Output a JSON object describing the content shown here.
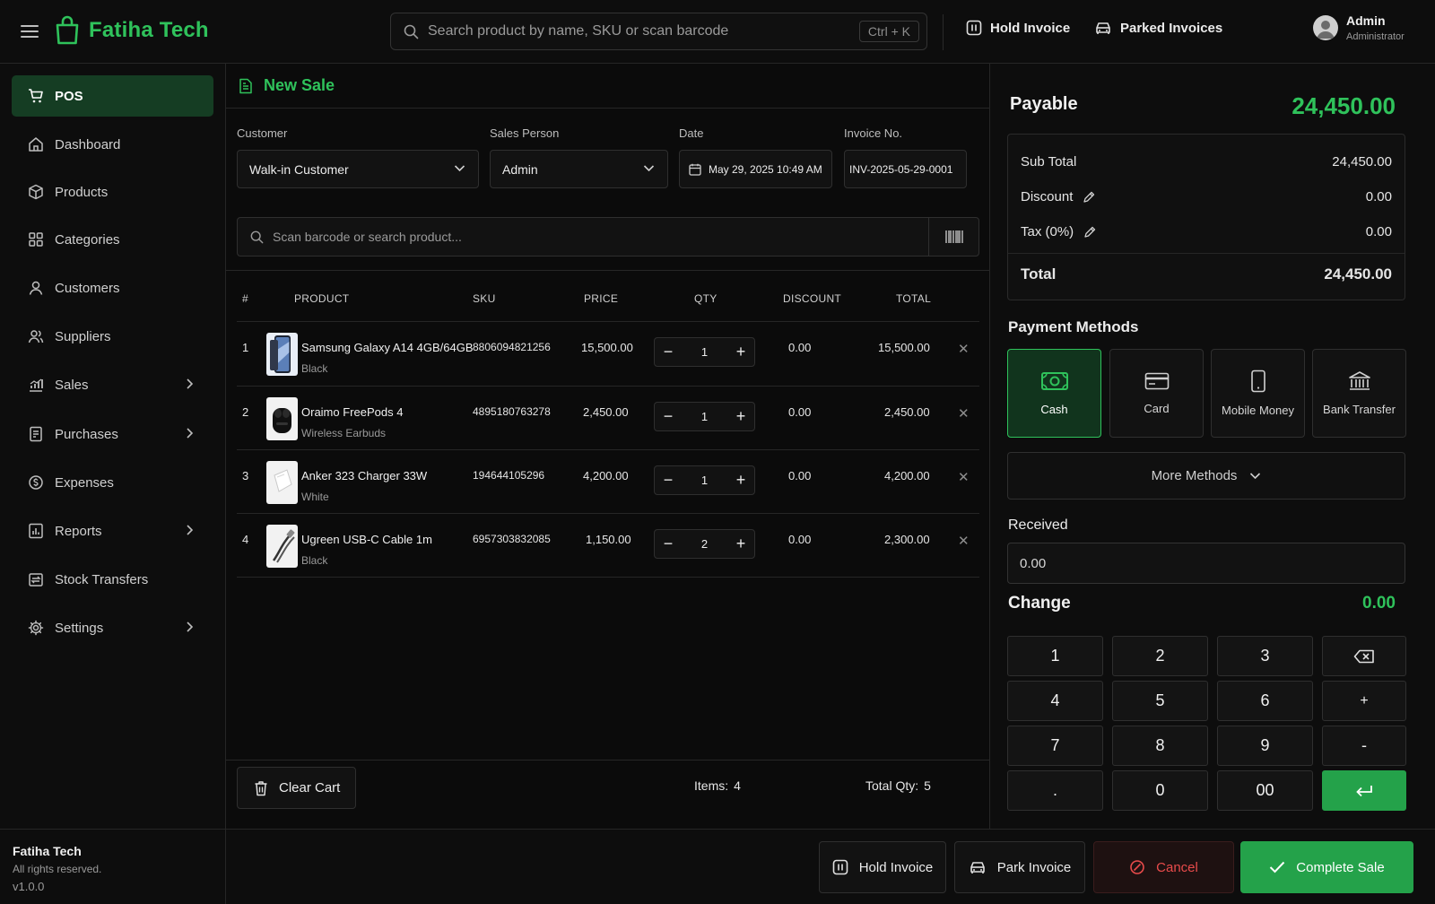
{
  "app": {
    "name": "Fatiha Tech",
    "search_placeholder": "Search product by name, SKU or scan barcode",
    "search_shortcut": "Ctrl + K",
    "hold_invoice": "Hold Invoice",
    "parked_invoices": "Parked Invoices",
    "user": {
      "name": "Admin",
      "role": "Administrator"
    }
  },
  "sidebar": {
    "items": [
      {
        "label": "POS",
        "icon": "cart-icon",
        "active": true
      },
      {
        "label": "Dashboard",
        "icon": "home-icon"
      },
      {
        "label": "Products",
        "icon": "box-icon"
      },
      {
        "label": "Categories",
        "icon": "grid-icon"
      },
      {
        "label": "Customers",
        "icon": "user-icon"
      },
      {
        "label": "Suppliers",
        "icon": "users-icon"
      },
      {
        "label": "Sales",
        "icon": "chart-icon",
        "expandable": true
      },
      {
        "label": "Purchases",
        "icon": "receipt-icon",
        "expandable": true
      },
      {
        "label": "Expenses",
        "icon": "coin-icon"
      },
      {
        "label": "Reports",
        "icon": "report-icon",
        "expandable": true
      },
      {
        "label": "Stock Transfers",
        "icon": "transfer-icon"
      },
      {
        "label": "Settings",
        "icon": "gear-icon",
        "expandable": true
      }
    ],
    "footer": {
      "name": "Fatiha Tech",
      "rights": "All rights reserved.",
      "version": "v1.0.0"
    }
  },
  "sale": {
    "title": "New Sale",
    "customer_label": "Customer",
    "customer_value": "Walk-in Customer",
    "salesperson_label": "Sales Person",
    "salesperson_value": "Admin",
    "date_label": "Date",
    "date_value": "May 29, 2025 10:49 AM",
    "invoice_label": "Invoice No.",
    "invoice_value": "INV-2025-05-29-0001",
    "scan_placeholder": "Scan barcode or search product...",
    "columns": [
      "#",
      "PRODUCT",
      "SKU",
      "PRICE",
      "QTY",
      "DISCOUNT",
      "TOTAL"
    ],
    "rows": [
      {
        "num": "1",
        "name": "Samsung Galaxy A14 4GB/64GB",
        "variant": "Black",
        "sku": "8806094821256",
        "price": "15,500.00",
        "qty": "1",
        "discount": "0.00",
        "total": "15,500.00",
        "img": "phone"
      },
      {
        "num": "2",
        "name": "Oraimo FreePods 4",
        "variant": "Wireless Earbuds",
        "sku": "4895180763278",
        "price": "2,450.00",
        "qty": "1",
        "discount": "0.00",
        "total": "2,450.00",
        "img": "earbuds"
      },
      {
        "num": "3",
        "name": "Anker 323 Charger 33W",
        "variant": "White",
        "sku": "194644105296",
        "price": "4,200.00",
        "qty": "1",
        "discount": "0.00",
        "total": "4,200.00",
        "img": "charger"
      },
      {
        "num": "4",
        "name": "Ugreen USB-C Cable 1m",
        "variant": "Black",
        "sku": "6957303832085",
        "price": "1,150.00",
        "qty": "2",
        "discount": "0.00",
        "total": "2,300.00",
        "img": "cable"
      }
    ],
    "clear_cart": "Clear Cart",
    "items_label": "Items:",
    "items_value": "4",
    "total_qty_label": "Total Qty:",
    "total_qty_value": "5"
  },
  "payment": {
    "payable_label": "Payable",
    "payable_value": "24,450.00",
    "subtotal_label": "Sub Total",
    "subtotal_value": "24,450.00",
    "discount_label": "Discount",
    "discount_value": "0.00",
    "tax_label": "Tax (0%)",
    "tax_value": "0.00",
    "total_label": "Total",
    "total_value": "24,450.00",
    "methods_title": "Payment Methods",
    "methods": [
      {
        "label": "Cash",
        "icon": "cash-icon",
        "active": true
      },
      {
        "label": "Card",
        "icon": "card-icon"
      },
      {
        "label": "Mobile Money",
        "icon": "mobile-icon"
      },
      {
        "label": "Bank Transfer",
        "icon": "bank-icon"
      }
    ],
    "more_methods": "More Methods",
    "received_label": "Received",
    "received_value": "0.00",
    "change_label": "Change",
    "change_value": "0.00",
    "keypad": [
      "1",
      "2",
      "3",
      "⌫",
      "4",
      "5",
      "6",
      "+",
      "7",
      "8",
      "9",
      "-",
      ".",
      "0",
      "00",
      "↵"
    ]
  },
  "actions": {
    "hold_invoice": "Hold Invoice",
    "park_invoice": "Park Invoice",
    "cancel": "Cancel",
    "complete_sale": "Complete Sale"
  },
  "colors": {
    "accent": "#2fc25b",
    "accent_dark": "#24a24a",
    "danger": "#e84b4b",
    "background": "#0b0b0b"
  }
}
